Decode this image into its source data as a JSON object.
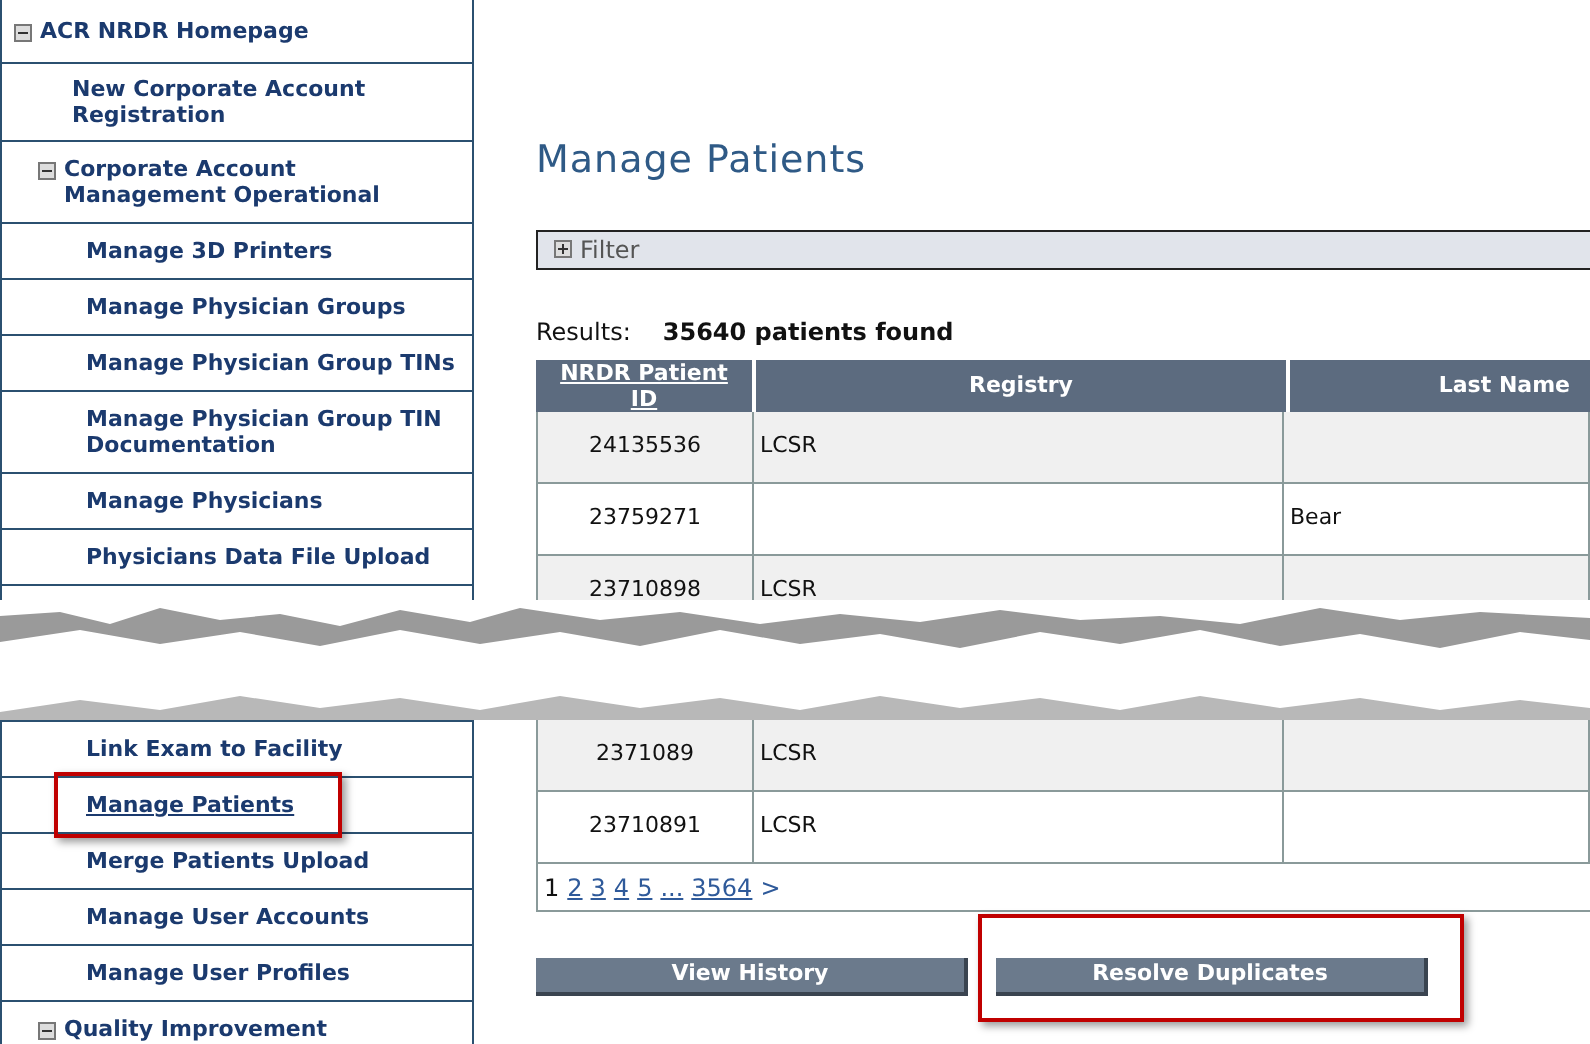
{
  "sidebar": {
    "upper": [
      {
        "label": "ACR NRDR Homepage",
        "expanded": true,
        "children": [
          {
            "label": "New Corporate Account Registration"
          },
          {
            "label": "Corporate Account Management Operational",
            "expanded": true,
            "children": [
              {
                "label": "Manage 3D Printers",
                "selected": false
              },
              {
                "label": "Manage Physician Groups",
                "selected": false
              },
              {
                "label": "Manage Physician Group TINs",
                "selected": false
              },
              {
                "label": "Manage Physician Group TIN Documentation",
                "selected": false
              },
              {
                "label": "Manage Physicians",
                "selected": false
              },
              {
                "label": "Physicians Data File Upload",
                "selected": false
              }
            ]
          }
        ]
      }
    ],
    "lower": [
      {
        "kind": "link",
        "label": "Link Exam to Facility",
        "selected": false
      },
      {
        "kind": "link",
        "label": "Manage Patients",
        "selected": true,
        "highlighted": true
      },
      {
        "kind": "link",
        "label": "Merge Patients Upload",
        "selected": false
      },
      {
        "kind": "link",
        "label": "Manage User Accounts",
        "selected": false
      },
      {
        "kind": "link",
        "label": "Manage User Profiles",
        "selected": false
      },
      {
        "kind": "section",
        "label": "Quality Improvement",
        "expanded": true
      }
    ]
  },
  "page_title": "Manage Patients",
  "filter": {
    "label": "Filter",
    "expanded": false
  },
  "results": {
    "label": "Results:",
    "count": "35640 patients found"
  },
  "table": {
    "columns": [
      {
        "label": "NRDR Patient ID",
        "sortable": true
      },
      {
        "label": "Registry",
        "sortable": false
      },
      {
        "label": "Last Name",
        "sortable": false
      }
    ],
    "upper_rows": [
      [
        "24135536",
        "LCSR",
        ""
      ],
      [
        "23759271",
        "",
        "Bear"
      ],
      [
        "23710898",
        "LCSR",
        ""
      ]
    ],
    "lower_rows": [
      [
        "2371089",
        "LCSR",
        ""
      ],
      [
        "23710891",
        "LCSR",
        ""
      ]
    ]
  },
  "pagination": [
    {
      "kind": "page",
      "label": "1",
      "selected": true
    },
    {
      "kind": "page",
      "label": "2",
      "selected": false
    },
    {
      "kind": "page",
      "label": "3",
      "selected": false
    },
    {
      "kind": "page",
      "label": "4",
      "selected": false
    },
    {
      "kind": "page",
      "label": "5",
      "selected": false
    },
    {
      "kind": "page",
      "label": "...",
      "selected": false
    },
    {
      "kind": "page",
      "label": "3564",
      "selected": false
    },
    {
      "kind": "next",
      "label": ">"
    }
  ],
  "buttons": [
    {
      "label": "View History"
    },
    {
      "label": "Resolve Duplicates",
      "highlighted": true
    }
  ]
}
